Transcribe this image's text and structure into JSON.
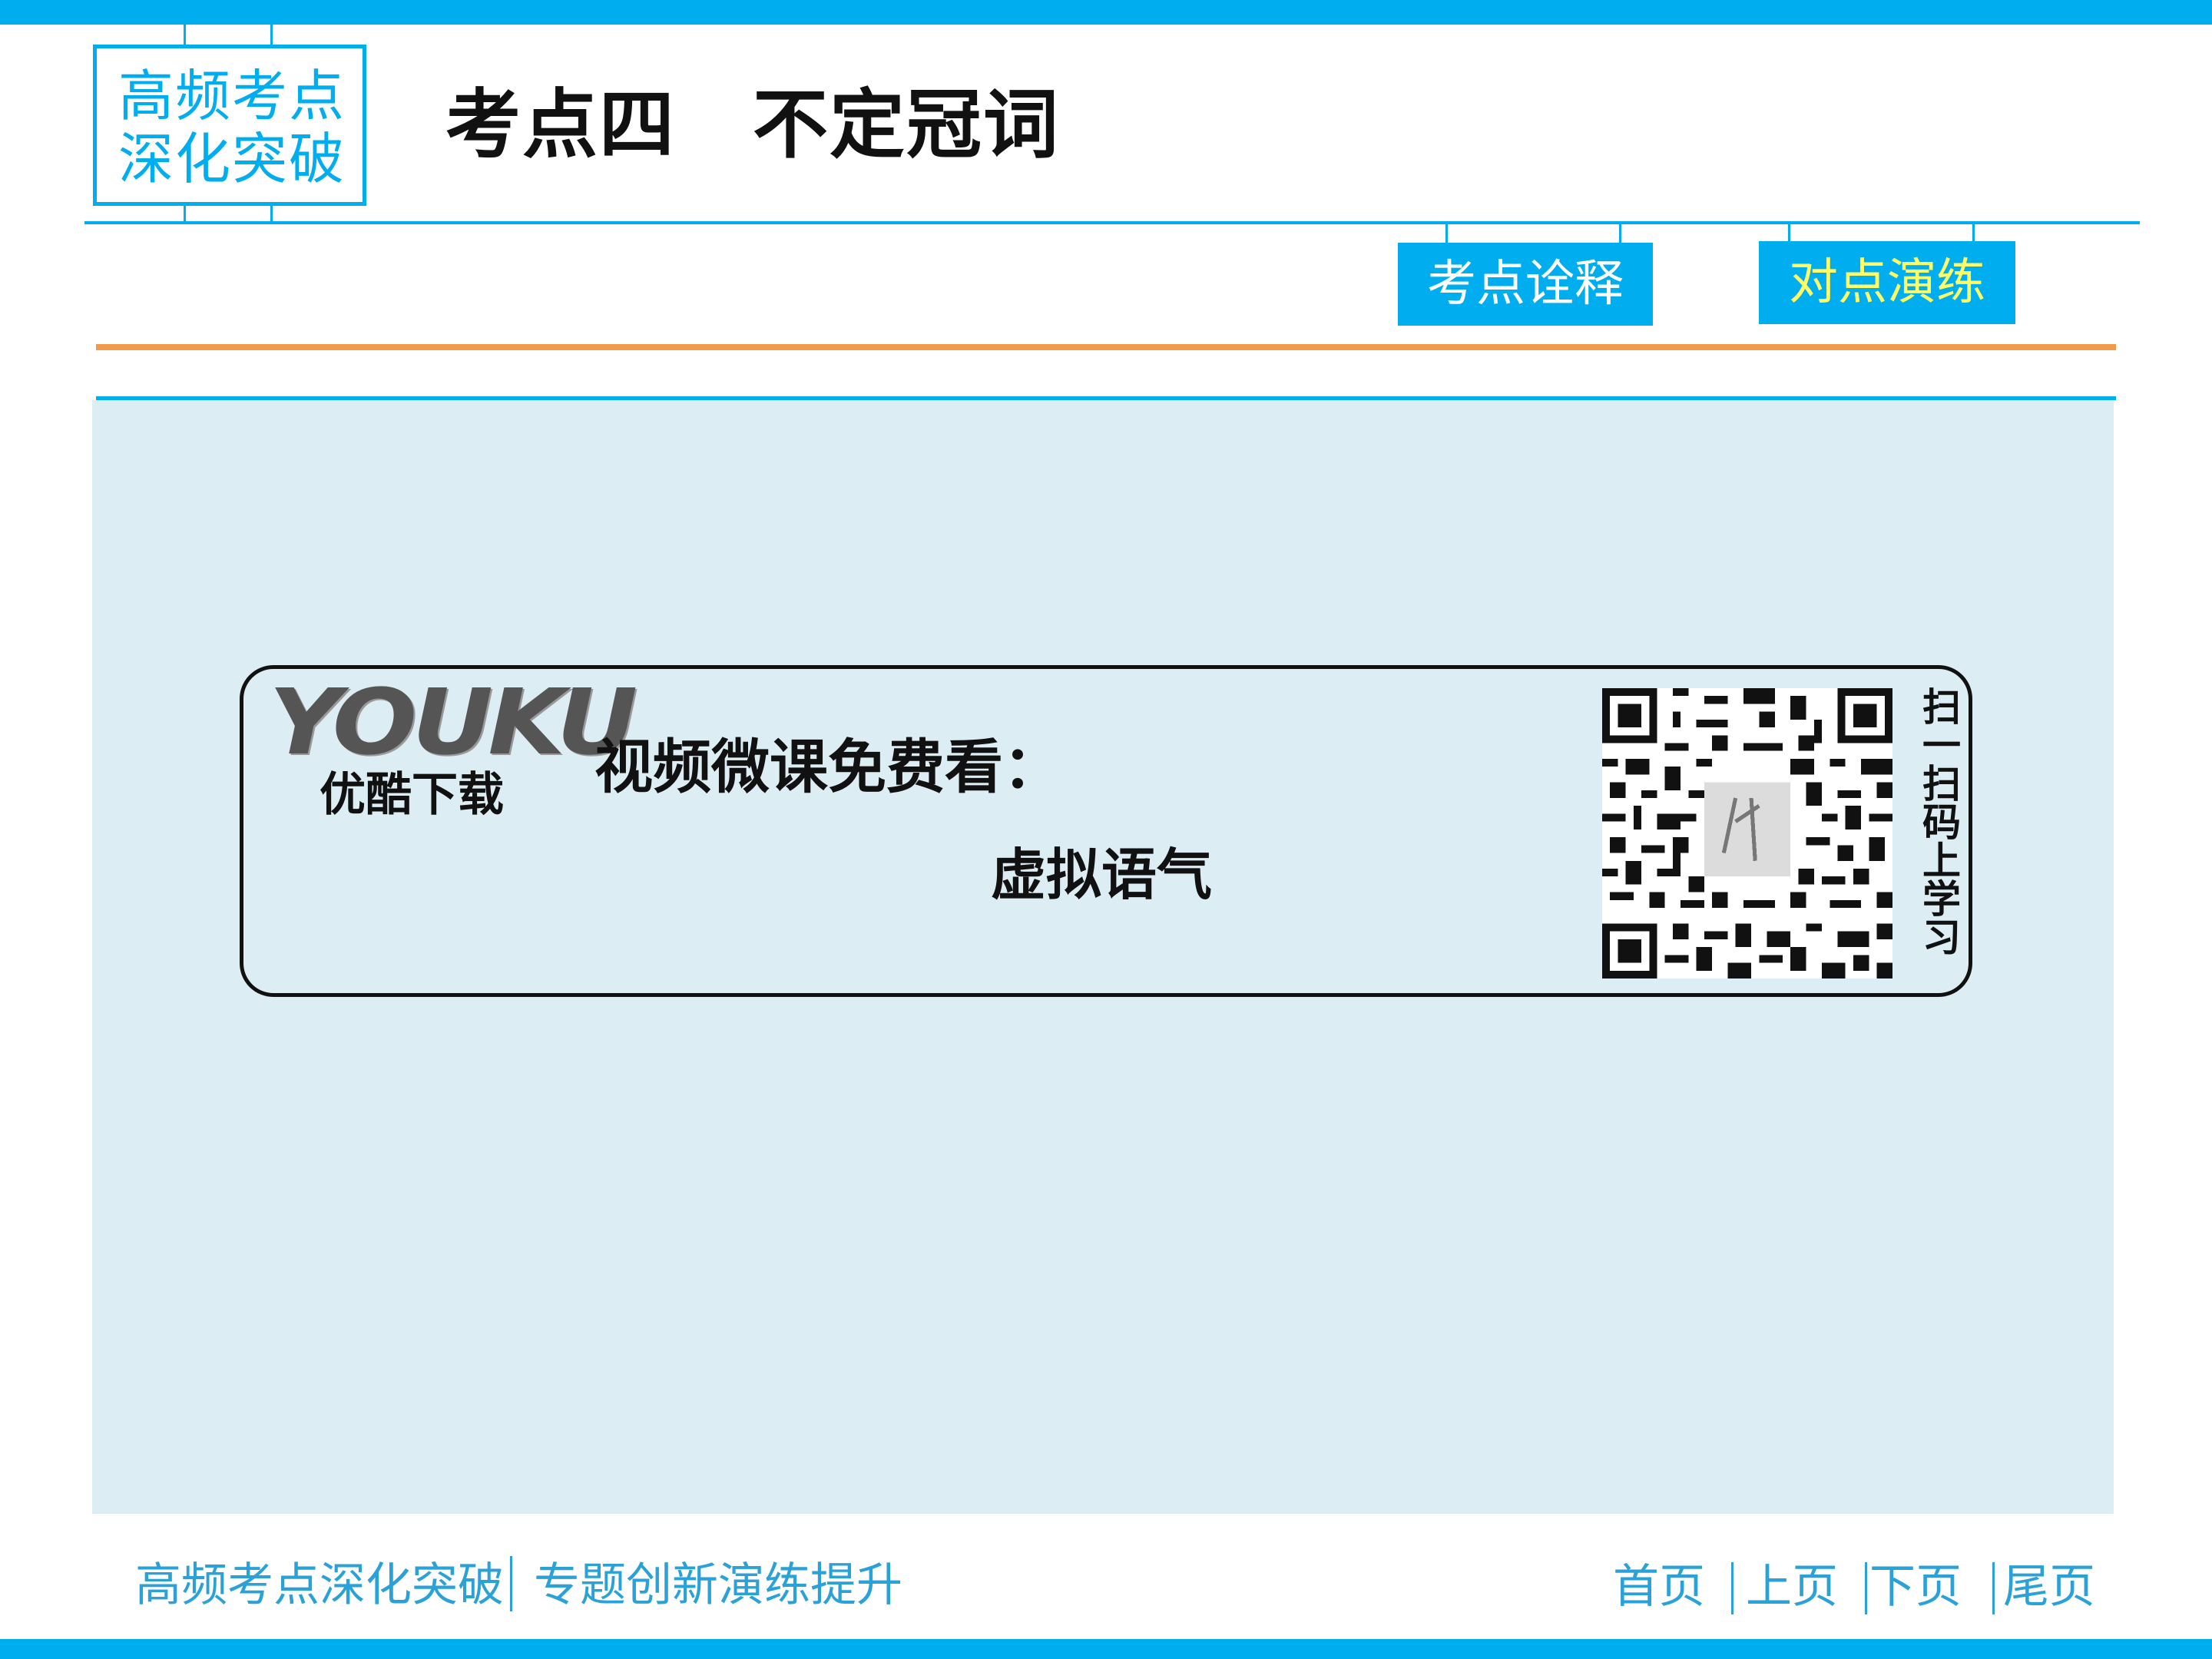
{
  "header": {
    "badge_line1": "高频考点",
    "badge_line2": "深化突破",
    "title": "考点四　不定冠词"
  },
  "tabs": [
    {
      "label": "考点诠释",
      "color": "#ffffff"
    },
    {
      "label": "对点演练",
      "color": "#ffff66"
    }
  ],
  "banner": {
    "logo_text": "YOUKU",
    "logo_sub": "优酷下载",
    "title": "视频微课免费看：",
    "topic": "虚拟语气",
    "qr_caption": "扫一扫码上学习"
  },
  "footer": {
    "left": "高频考点深化突破",
    "right": "专题创新演练提升",
    "nav": [
      "首页",
      "上页",
      "下页",
      "尾页"
    ]
  },
  "colors": {
    "accent_blue": "#00aeef",
    "accent_orange": "#f29a4a",
    "content_bg": "#dcedf3",
    "footer_text": "#2aa2d8"
  }
}
